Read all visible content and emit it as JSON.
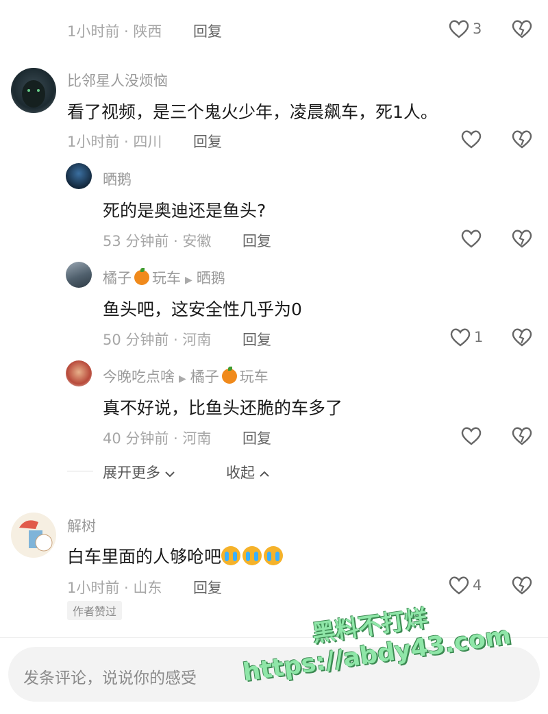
{
  "comments": [
    {
      "meta": "1小时前 · 陕西",
      "reply": "回复",
      "likes": "3"
    },
    {
      "name": "比邻星人没烦恼",
      "text": "看了视频，是三个鬼火少年，凌晨飙车，死1人。",
      "meta": "1小时前 · 四川",
      "reply": "回复",
      "likes": ""
    },
    {
      "name": "晒鹅",
      "text": "死的是奥迪还是鱼头?",
      "meta": "53 分钟前 · 安徽",
      "reply": "回复",
      "likes": ""
    },
    {
      "name": "橘子",
      "name_suffix": "玩车",
      "reply_to": "晒鹅",
      "text": "鱼头吧，这安全性几乎为0",
      "meta": "50 分钟前 · 河南",
      "reply": "回复",
      "likes": "1"
    },
    {
      "name": "今晚吃点啥",
      "reply_to": "橘子",
      "reply_to_suffix": "玩车",
      "text": "真不好说，比鱼头还脆的车多了",
      "meta": "40 分钟前 · 河南",
      "reply": "回复",
      "likes": ""
    },
    {
      "name": "解树",
      "text": "白车里面的人够呛吧",
      "meta": "1小时前 · 山东",
      "reply": "回复",
      "likes": "4",
      "badge": "作者赞过"
    }
  ],
  "expand_more": "展开更多",
  "collapse": "收起",
  "composer_placeholder": "发条评论，说说你的感受",
  "watermark": {
    "line1": "黑料不打烊",
    "line2": "https://abdy43.com"
  }
}
